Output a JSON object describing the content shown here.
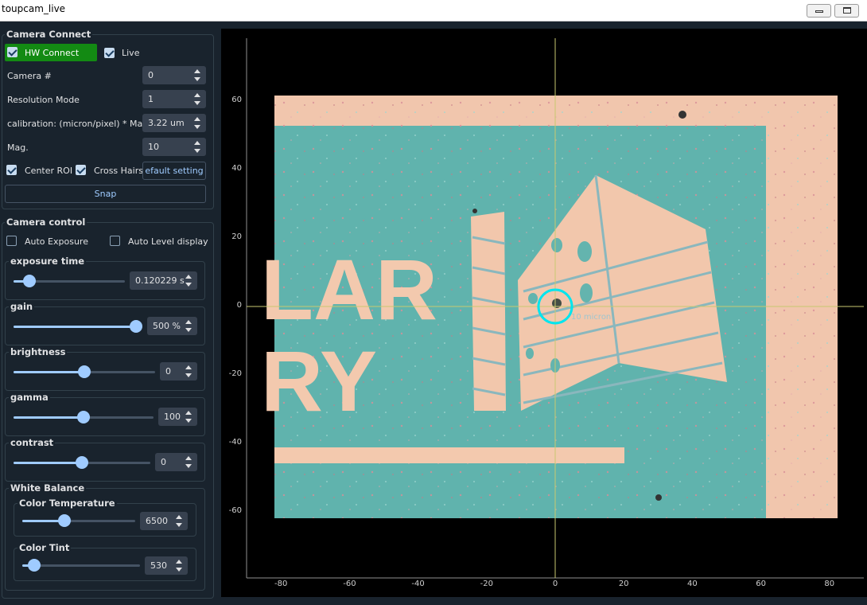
{
  "window": {
    "title": "toupcam_live"
  },
  "camera_connect": {
    "title": "Camera Connect",
    "hw_connect": {
      "label": "HW Connect",
      "checked": true
    },
    "live": {
      "label": "Live",
      "checked": true
    },
    "camera_number": {
      "label": "Camera #",
      "value": "0"
    },
    "resolution_mode": {
      "label": "Resolution Mode",
      "value": "1"
    },
    "calibration": {
      "label": "calibration: (micron/pixel) * Mag.",
      "value": "3.22 um"
    },
    "mag": {
      "label": "Mag.",
      "value": "10"
    },
    "center_roi": {
      "label": "Center ROI",
      "checked": true
    },
    "cross_hairs": {
      "label": "Cross Hairs",
      "checked": true
    },
    "default_setting_label": "efault setting",
    "snap_label": "Snap"
  },
  "camera_control": {
    "title": "Camera control",
    "auto_exposure": {
      "label": "Auto Exposure",
      "checked": false
    },
    "auto_level": {
      "label": "Auto Level display",
      "checked": false
    },
    "exposure_time": {
      "label": "exposure time",
      "value": "0.120229 s",
      "level": 0.1
    },
    "gain": {
      "label": "gain",
      "value": "500 %",
      "level": 1.0
    },
    "brightness": {
      "label": "brightness",
      "value": "0",
      "level": 0.5
    },
    "gamma": {
      "label": "gamma",
      "value": "100",
      "level": 0.5
    },
    "contrast": {
      "label": "contrast",
      "value": "0",
      "level": 0.5
    },
    "white_balance": {
      "title": "White Balance",
      "color_temperature": {
        "label": "Color Temperature",
        "value": "6500",
        "level": 0.36
      },
      "color_tint": {
        "label": "Color Tint",
        "value": "530",
        "level": 0.05
      }
    }
  },
  "plot": {
    "x_ticks": [
      "-80",
      "-60",
      "-40",
      "-20",
      "0",
      "20",
      "40",
      "60",
      "80"
    ],
    "y_ticks": [
      "60",
      "40",
      "20",
      "0",
      "-20",
      "-40",
      "-60"
    ],
    "roi_label": "10 micron",
    "image_text_1": "LAR",
    "image_text_2": "RY",
    "colors": {
      "background": "#000000",
      "image_bg": "#f2c8b0",
      "substrate": "#5fb4ae",
      "crosshair": "#c8c870",
      "roi_circle": "#00e5ee"
    }
  }
}
